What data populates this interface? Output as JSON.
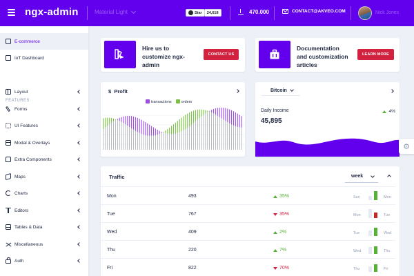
{
  "header": {
    "brand": "ngx-admin",
    "theme": "Material Light",
    "github": {
      "star_label": "Star",
      "count": "24,618"
    },
    "downloads": "470.000",
    "contact": "CONTACT@AKVEO.COM",
    "user_name": "Nick Jones"
  },
  "sidebar": {
    "items": [
      {
        "label": "E-commerce",
        "icon": "shopping-cart-icon",
        "active": true
      },
      {
        "label": "IoT Dashboard",
        "icon": "home-icon"
      }
    ],
    "group_label": "FEATURES",
    "features": [
      {
        "label": "Layout",
        "icon": "layout-icon"
      },
      {
        "label": "Forms",
        "icon": "edit-icon"
      },
      {
        "label": "UI Features",
        "icon": "keypad-icon"
      },
      {
        "label": "Modal & Overlays",
        "icon": "browser-icon"
      },
      {
        "label": "Extra Components",
        "icon": "message-circle-icon"
      },
      {
        "label": "Maps",
        "icon": "map-icon"
      },
      {
        "label": "Charts",
        "icon": "pie-chart-icon"
      },
      {
        "label": "Editors",
        "icon": "text-icon"
      },
      {
        "label": "Tables & Data",
        "icon": "grid-icon"
      },
      {
        "label": "Miscellaneous",
        "icon": "shuffle-icon"
      },
      {
        "label": "Auth",
        "icon": "lock-icon"
      }
    ]
  },
  "promo": [
    {
      "text_line1": "Hire us to",
      "text_line2": "customize ngx-",
      "text_line3": "admin",
      "button": "CONTACT US",
      "icon": "layers-icon"
    },
    {
      "text_line1": "Documentation",
      "text_line2": "and customization",
      "text_line3": "articles",
      "button": "LEARN MORE",
      "icon": "briefcase-icon"
    }
  ],
  "profit": {
    "title": "Profit",
    "currency_symbol": "$",
    "legend": [
      {
        "name": "transactions",
        "color": "#9c4de6"
      },
      {
        "name": "orders",
        "color": "#7ac142"
      }
    ]
  },
  "income": {
    "currency": "Bitcoin",
    "label": "Daily Income",
    "value": "45,895",
    "delta": "4%",
    "color": "#6200ee"
  },
  "traffic": {
    "title": "Traffic",
    "period": "week",
    "rows": [
      {
        "day": "Mon",
        "value": "493",
        "delta": "35%",
        "trend": "up",
        "prev": "Sun",
        "curr": "Mon",
        "prev_level": 0.45,
        "curr_level": 0.9,
        "curr_color": "#56b236"
      },
      {
        "day": "Tue",
        "value": "767",
        "delta": "35%",
        "trend": "down",
        "prev": "Mon",
        "curr": "Tue",
        "prev_level": 0.9,
        "curr_level": 0.55,
        "curr_color": "#c62828"
      },
      {
        "day": "Wed",
        "value": "409",
        "delta": "2%",
        "trend": "up",
        "prev": "Tue",
        "curr": "Wed",
        "prev_level": 0.55,
        "curr_level": 0.85,
        "curr_color": "#56b236"
      },
      {
        "day": "Thu",
        "value": "220",
        "delta": "7%",
        "trend": "up",
        "prev": "Wed",
        "curr": "Thu",
        "prev_level": 0.7,
        "curr_level": 0.8,
        "curr_color": "#56b236"
      },
      {
        "day": "Fri",
        "value": "822",
        "delta": "70%",
        "trend": "down",
        "prev": "Thu",
        "curr": "Fri",
        "prev_level": 0.6,
        "curr_level": 0.8,
        "curr_color": "#56b236"
      }
    ]
  }
}
